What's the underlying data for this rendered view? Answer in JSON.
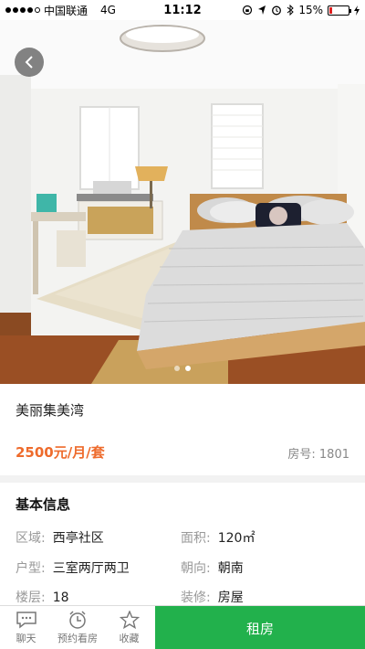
{
  "status_bar": {
    "carrier": "中国联通",
    "network": "4G",
    "time": "11:12",
    "battery": "15%",
    "battery_level": 0.15
  },
  "listing": {
    "title": "美丽集美湾",
    "price": "2500元/月/套",
    "room_number": "房号: 1801",
    "photo_pages": 2,
    "photo_active_index": 1
  },
  "basic_info": {
    "heading": "基本信息",
    "fields": [
      {
        "label": "区域:",
        "value": "西亭社区"
      },
      {
        "label": "面积:",
        "value": "120㎡"
      },
      {
        "label": "户型:",
        "value": "三室两厅两卫"
      },
      {
        "label": "朝向:",
        "value": "朝南"
      },
      {
        "label": "楼层:",
        "value": "18"
      },
      {
        "label": "装修:",
        "value": "房屋"
      }
    ]
  },
  "bottom_bar": {
    "chat": "聊天",
    "schedule": "预约看房",
    "favorite": "收藏",
    "rent": "租房"
  },
  "colors": {
    "price": "#ee6b2c",
    "rent_button": "#22b14c"
  }
}
